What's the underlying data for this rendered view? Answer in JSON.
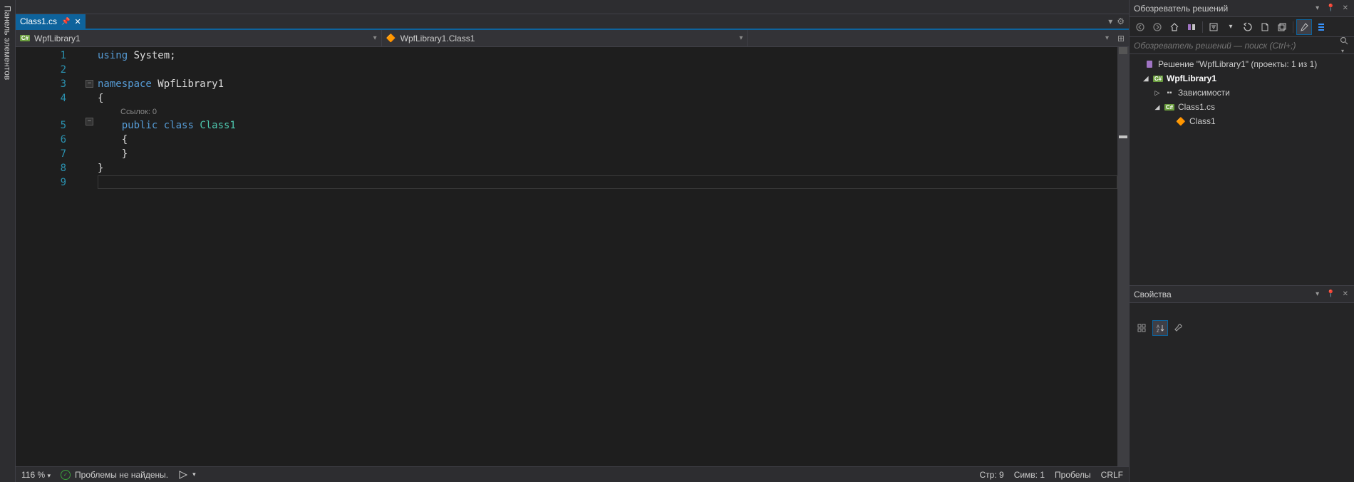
{
  "toolbox": {
    "label": "Панель элементов"
  },
  "tab": {
    "name": "Class1.cs"
  },
  "dropdowns": {
    "project": "WpfLibrary1",
    "class": "WpfLibrary1.Class1",
    "member": ""
  },
  "code": {
    "lines": [
      "1",
      "2",
      "3",
      "4",
      "5",
      "6",
      "7",
      "8",
      "9"
    ],
    "l1_using": "using",
    "l1_system": "System",
    "l3_namespace": "namespace",
    "l3_name": "WpfLibrary1",
    "l4": "{",
    "codelens": "Ссылок: 0",
    "l5_public": "public",
    "l5_class": "class",
    "l5_name": "Class1",
    "l6": "{",
    "l7": "}",
    "l8": "}"
  },
  "status": {
    "zoom": "116 %",
    "problems": "Проблемы не найдены.",
    "line": "Стр: 9",
    "col": "Симв: 1",
    "indent": "Пробелы",
    "eol": "CRLF"
  },
  "solutionExplorer": {
    "title": "Обозреватель решений",
    "searchPlaceholder": "Обозреватель решений — поиск (Ctrl+;)",
    "solution": "Решение \"WpfLibrary1\" (проекты: 1 из 1)",
    "project": "WpfLibrary1",
    "dependencies": "Зависимости",
    "file": "Class1.cs",
    "classNode": "Class1"
  },
  "properties": {
    "title": "Свойства"
  }
}
